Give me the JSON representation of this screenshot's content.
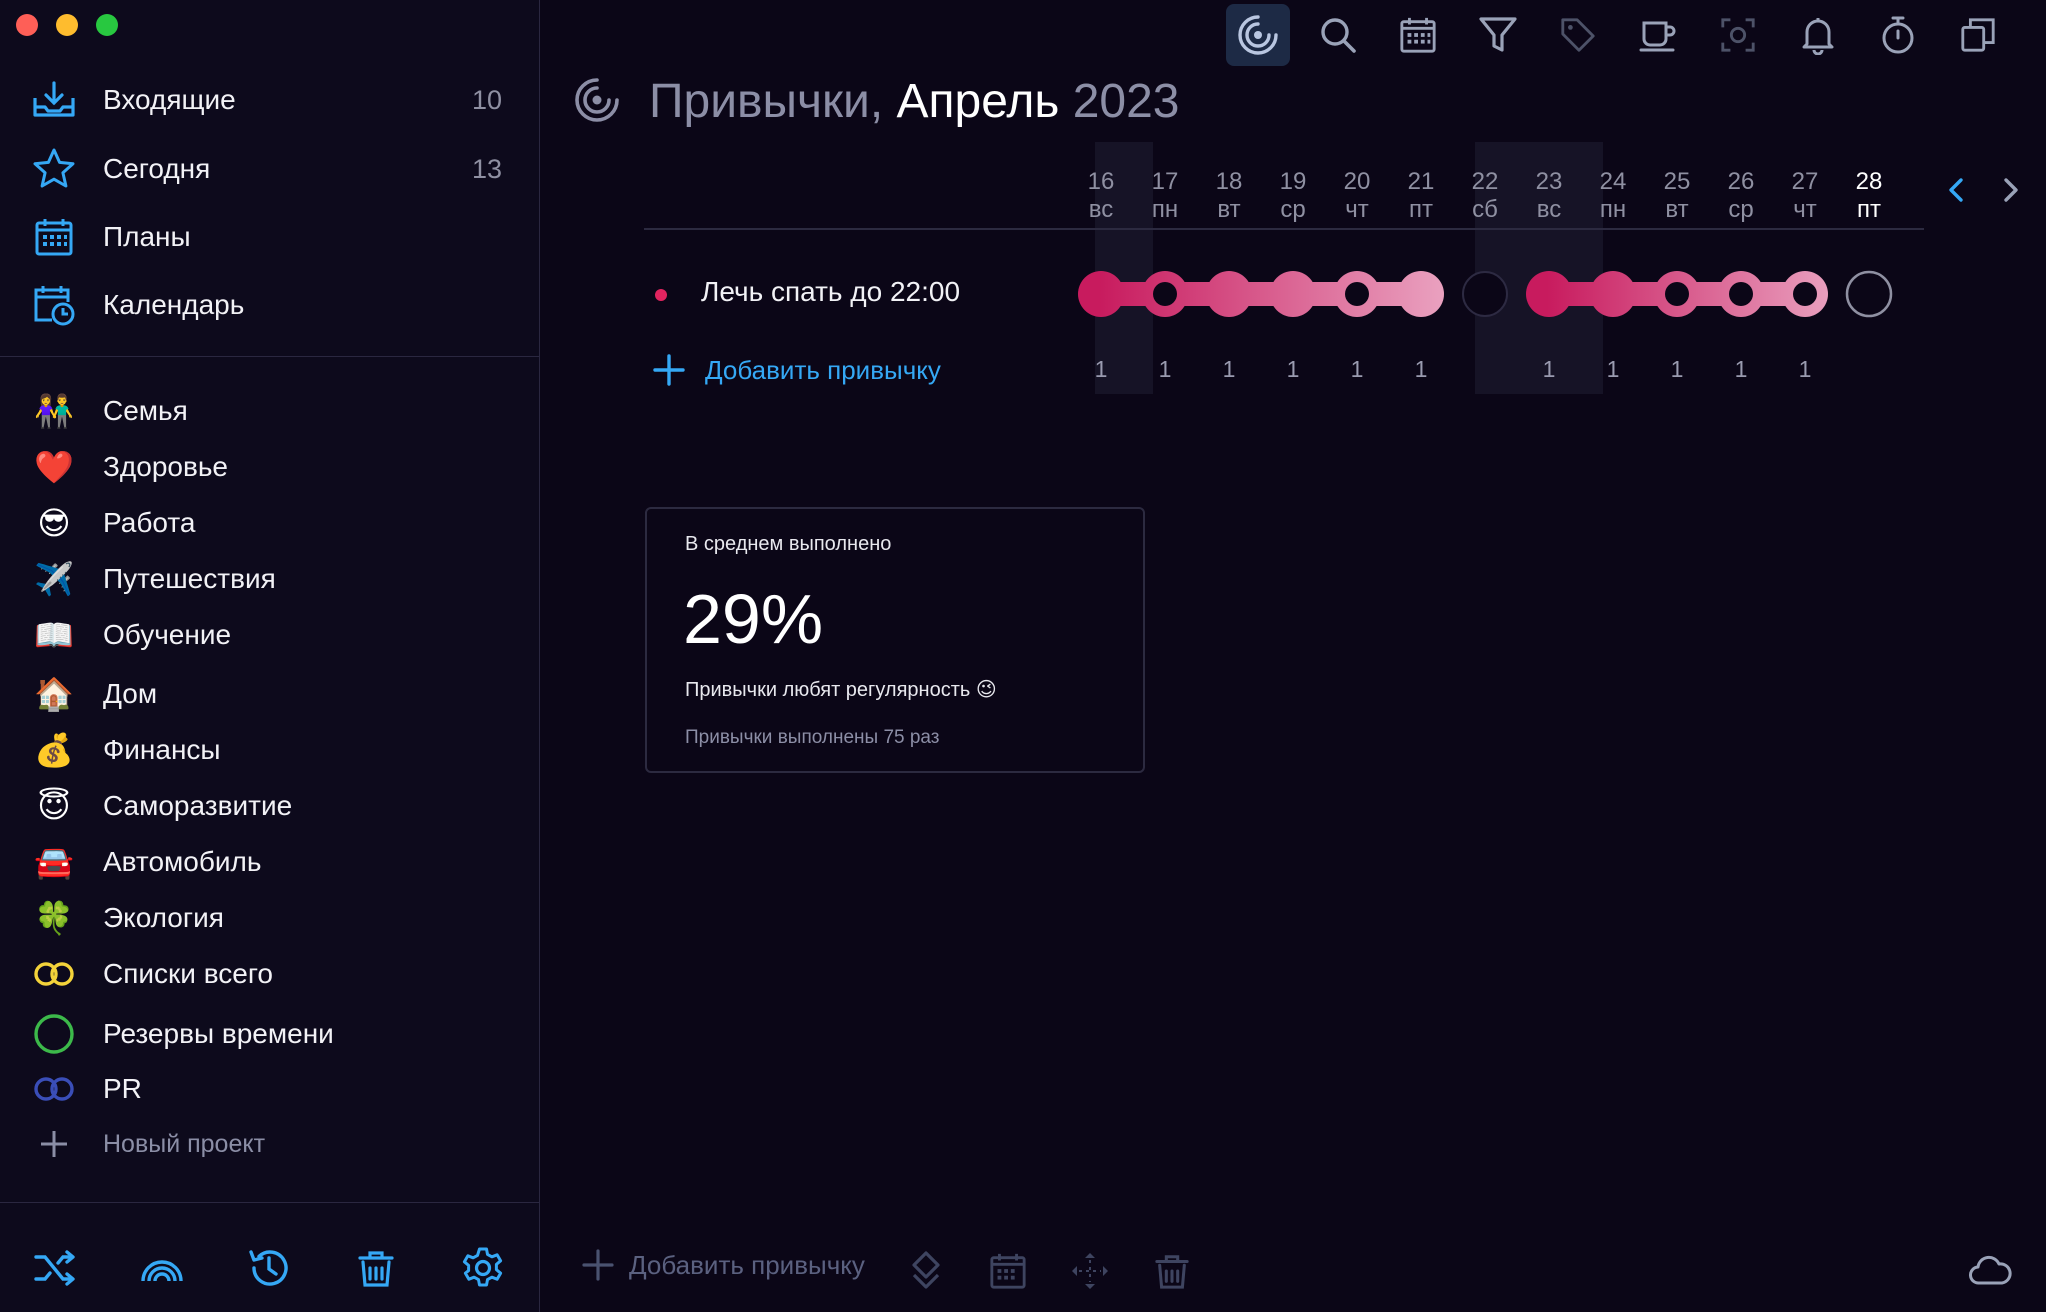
{
  "sidebar": {
    "main_items": [
      {
        "label": "Входящие",
        "count": "10",
        "icon": "inbox-icon"
      },
      {
        "label": "Сегодня",
        "count": "13",
        "icon": "star-icon"
      },
      {
        "label": "Планы",
        "count": "",
        "icon": "calendar-grid-icon"
      },
      {
        "label": "Календарь",
        "count": "",
        "icon": "calendar-clock-icon"
      }
    ],
    "projects": [
      {
        "label": "Семья",
        "emoji": "👫"
      },
      {
        "label": "Здоровье",
        "emoji": "❤️"
      },
      {
        "label": "Работа",
        "emoji": "😎"
      },
      {
        "label": "Путешествия",
        "emoji": "✈️"
      },
      {
        "label": "Обучение",
        "emoji": "📖"
      },
      {
        "label": "Дом",
        "emoji": "🏠"
      },
      {
        "label": "Финансы",
        "emoji": "💰"
      },
      {
        "label": "Саморазвитие",
        "emoji": "😇"
      },
      {
        "label": "Автомобиль",
        "emoji": "🚘"
      },
      {
        "label": "Экология",
        "emoji": "🍀"
      },
      {
        "label": "Списки всего",
        "icon": "yellow-rings-icon"
      },
      {
        "label": "Резервы времени",
        "icon": "green-circle-icon"
      },
      {
        "label": "PR",
        "icon": "blue-rings-icon"
      }
    ],
    "new_project_label": "Новый проект"
  },
  "header": {
    "title_prefix": "Привычки,",
    "title_month": "Апрель",
    "title_year": "2023"
  },
  "days": [
    {
      "num": "16",
      "wd": "вс"
    },
    {
      "num": "17",
      "wd": "пн"
    },
    {
      "num": "18",
      "wd": "вт"
    },
    {
      "num": "19",
      "wd": "ср"
    },
    {
      "num": "20",
      "wd": "чт"
    },
    {
      "num": "21",
      "wd": "пт"
    },
    {
      "num": "22",
      "wd": "сб"
    },
    {
      "num": "23",
      "wd": "вс"
    },
    {
      "num": "24",
      "wd": "пн"
    },
    {
      "num": "25",
      "wd": "вт"
    },
    {
      "num": "26",
      "wd": "ср"
    },
    {
      "num": "27",
      "wd": "чт"
    },
    {
      "num": "28",
      "wd": "пт"
    }
  ],
  "habit": {
    "name": "Лечь спать до 22:00",
    "counts": [
      "1",
      "1",
      "1",
      "1",
      "1",
      "1",
      "",
      "1",
      "1",
      "1",
      "1",
      "1",
      ""
    ],
    "dot_color": "#e1245f"
  },
  "add_habit_label": "Добавить привычку",
  "stats": {
    "caption": "В среднем выполнено",
    "percent": "29%",
    "message": "Привычки любят регулярность 😉",
    "total": "Привычки выполнены 75 раз"
  },
  "footer": {
    "add_label": "Добавить привычку"
  },
  "colors": {
    "accent": "#35a8f5",
    "chain_start": "#c81b5e",
    "chain_end": "#ecaac6",
    "background": "#0b0617"
  }
}
